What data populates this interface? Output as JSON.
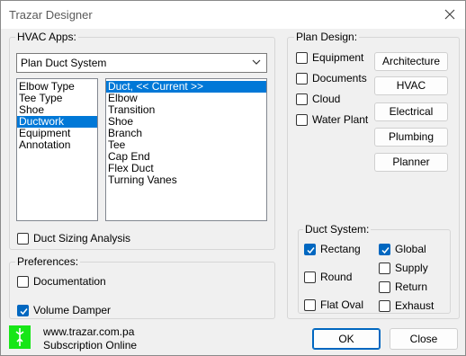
{
  "window": {
    "title": "Trazar Designer"
  },
  "hvac_apps": {
    "legend": "HVAC Apps:",
    "system_select": "Plan Duct System",
    "left_list": [
      "Elbow Type",
      "Tee Type",
      "Shoe",
      "Ductwork",
      "Equipment",
      "Annotation"
    ],
    "left_selected": "Ductwork",
    "right_list": [
      "Duct, << Current >>",
      "Elbow",
      "Transition",
      "Shoe",
      "Branch",
      "Tee",
      "Cap End",
      "Flex Duct",
      "Turning Vanes"
    ],
    "right_selected": "Duct, << Current >>",
    "duct_sizing": {
      "label": "Duct Sizing Analysis",
      "checked": false
    }
  },
  "preferences": {
    "legend": "Preferences:",
    "documentation": {
      "label": "Documentation",
      "checked": false
    },
    "volume_damper": {
      "label": "Volume Damper",
      "checked": true
    }
  },
  "plan_design": {
    "legend": "Plan Design:",
    "equipment": {
      "label": "Equipment",
      "checked": false
    },
    "documents": {
      "label": "Documents",
      "checked": false
    },
    "cloud": {
      "label": "Cloud",
      "checked": false
    },
    "water_plant": {
      "label": "Water Plant",
      "checked": false
    },
    "buttons": [
      "Architecture",
      "HVAC",
      "Electrical",
      "Plumbing",
      "Planner"
    ]
  },
  "duct_system": {
    "legend": "Duct System:",
    "rectang": {
      "label": "Rectang",
      "checked": true
    },
    "round": {
      "label": "Round",
      "checked": false
    },
    "flat_oval": {
      "label": "Flat Oval",
      "checked": false
    },
    "global": {
      "label": "Global",
      "checked": true
    },
    "supply": {
      "label": "Supply",
      "checked": false
    },
    "return": {
      "label": "Return",
      "checked": false
    },
    "exhaust": {
      "label": "Exhaust",
      "checked": false
    }
  },
  "footer": {
    "website": "www.trazar.com.pa",
    "subscription": "Subscription Online",
    "ok_label": "OK",
    "close_label": "Close"
  },
  "colors": {
    "accent": "#0067c0",
    "selection": "#0078d7",
    "logo": "#17e617"
  }
}
